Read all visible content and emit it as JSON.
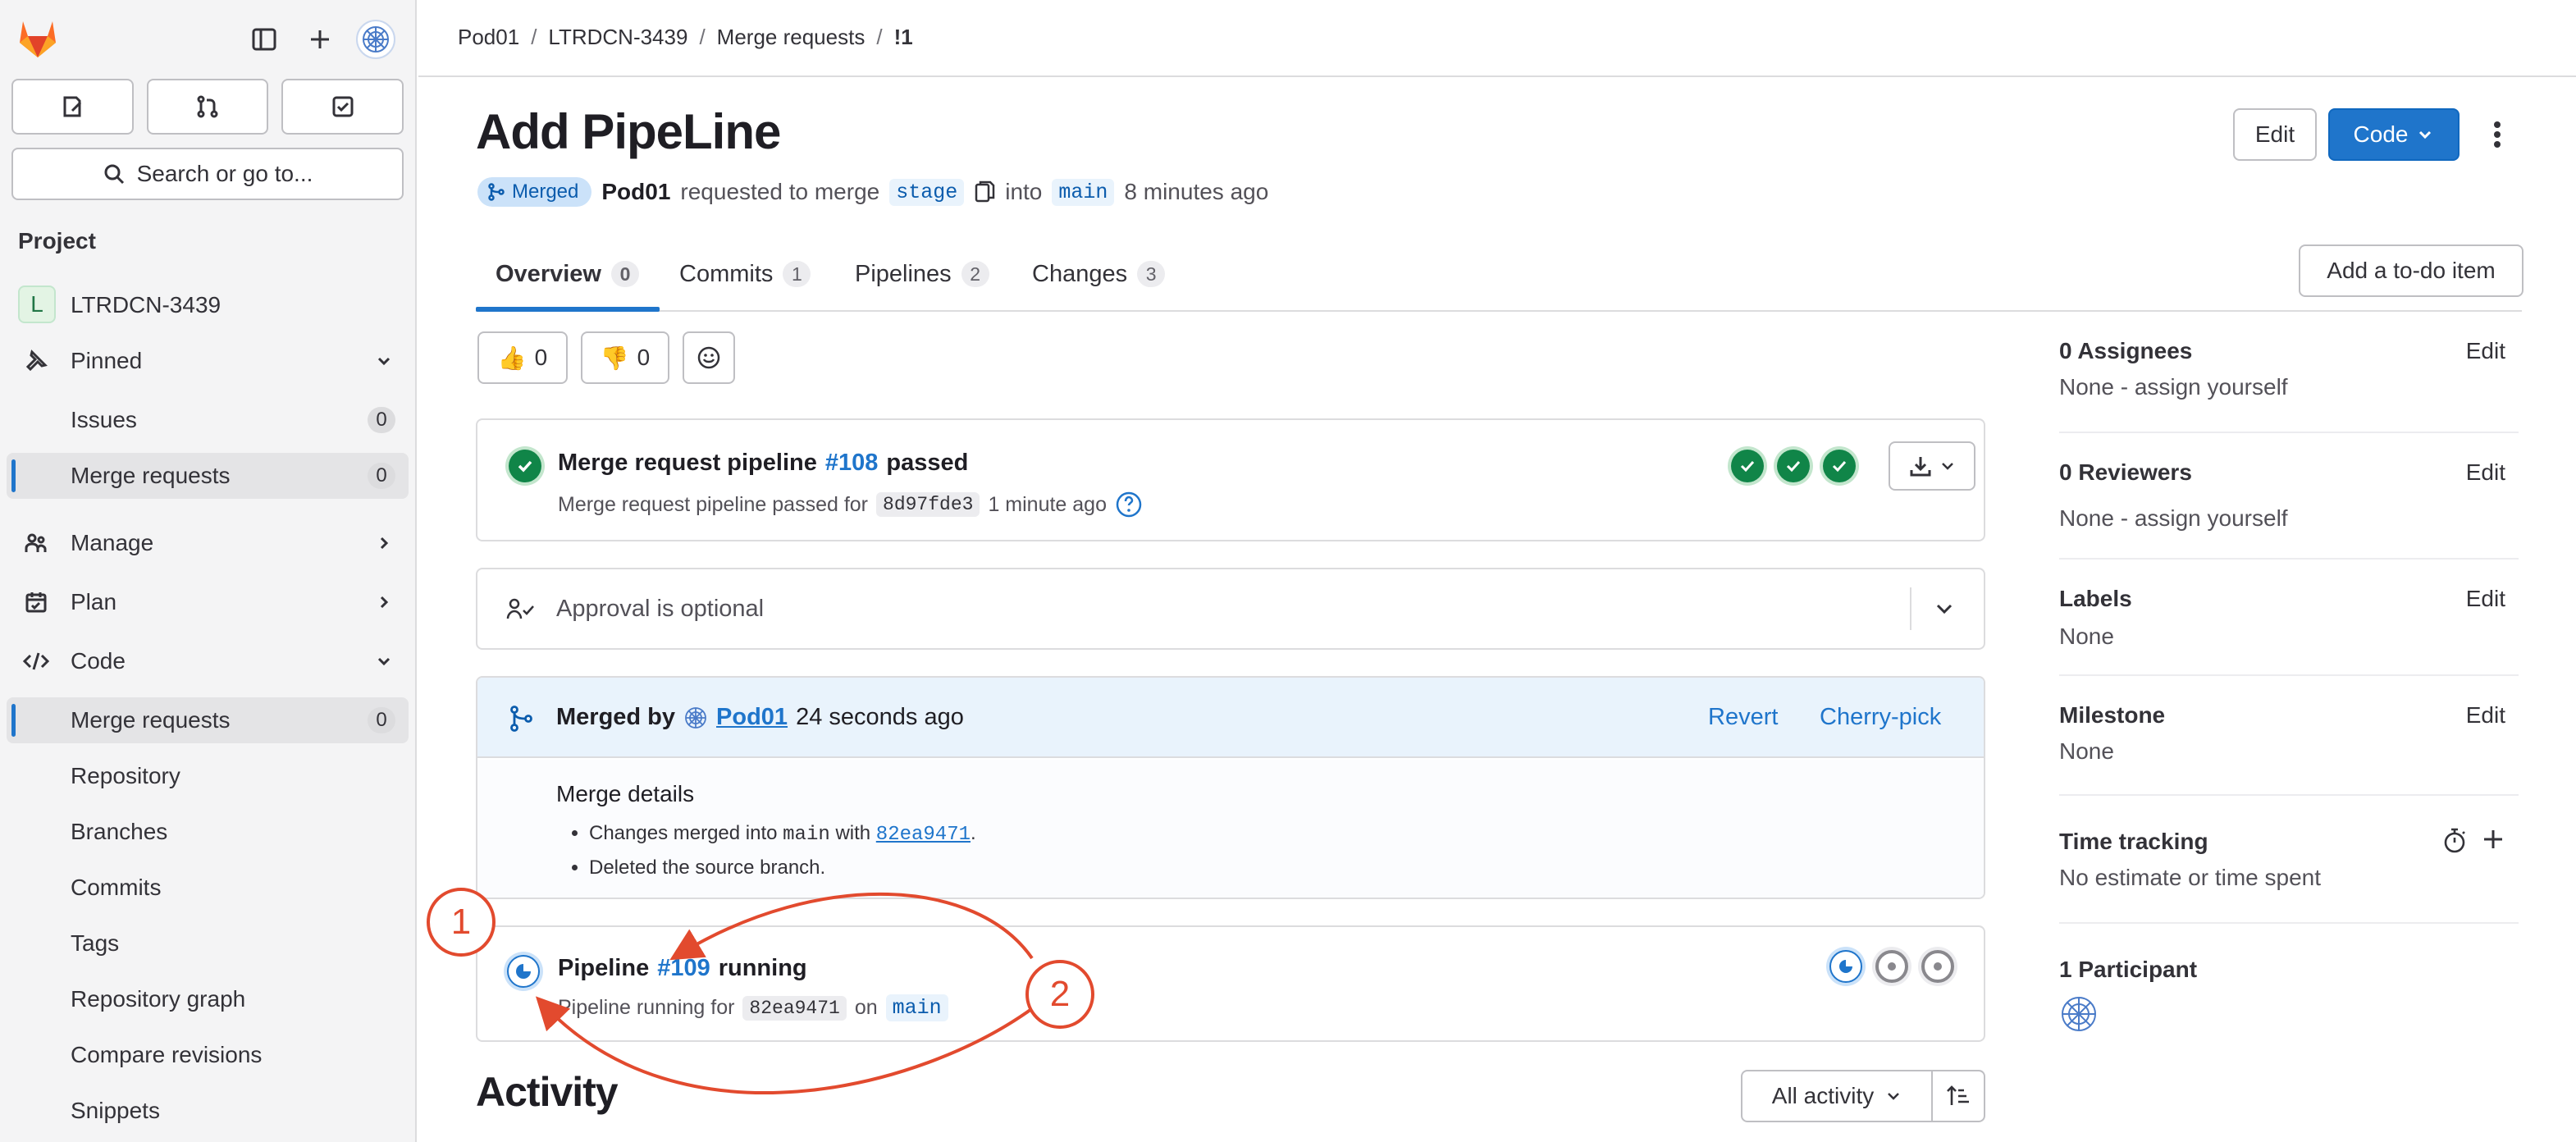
{
  "sidebar": {
    "search_label": "Search or go to...",
    "project_heading": "Project",
    "project_initial": "L",
    "project_name": "LTRDCN-3439",
    "pinned": "Pinned",
    "pinned_items": [
      {
        "label": "Issues",
        "count": "0"
      },
      {
        "label": "Merge requests",
        "count": "0"
      }
    ],
    "manage": "Manage",
    "plan": "Plan",
    "code": "Code",
    "code_items": [
      {
        "label": "Merge requests",
        "count": "0"
      },
      {
        "label": "Repository"
      },
      {
        "label": "Branches"
      },
      {
        "label": "Commits"
      },
      {
        "label": "Tags"
      },
      {
        "label": "Repository graph"
      },
      {
        "label": "Compare revisions"
      },
      {
        "label": "Snippets"
      }
    ]
  },
  "breadcrumb": [
    "Pod01",
    "LTRDCN-3439",
    "Merge requests",
    "!1"
  ],
  "mr": {
    "title": "Add PipeLine",
    "edit_label": "Edit",
    "code_label": "Code",
    "status": "Merged",
    "author": "Pod01",
    "requested_text": "requested to merge",
    "source_branch": "stage",
    "into_text": "into",
    "target_branch": "main",
    "time": "8 minutes ago",
    "todo_label": "Add a to-do item"
  },
  "tabs": [
    {
      "label": "Overview",
      "count": "0"
    },
    {
      "label": "Commits",
      "count": "1"
    },
    {
      "label": "Pipelines",
      "count": "2"
    },
    {
      "label": "Changes",
      "count": "3"
    }
  ],
  "reactions": {
    "thumbs_up": "0",
    "thumbs_down": "0"
  },
  "pipeline_card": {
    "prefix": "Merge request pipeline",
    "id": "#108",
    "status": "passed",
    "sub_prefix": "Merge request pipeline passed for",
    "sha": "8d97fde3",
    "time": "1 minute ago"
  },
  "approval": {
    "text": "Approval is optional"
  },
  "merged": {
    "by_label": "Merged by",
    "user": "Pod01",
    "time": "24 seconds ago",
    "revert": "Revert",
    "cherry_pick": "Cherry-pick",
    "details_title": "Merge details",
    "detail_1_pre": "Changes merged into",
    "detail_1_branch": "main",
    "detail_1_with": "with",
    "detail_1_sha": "82ea9471",
    "detail_2": "Deleted the source branch."
  },
  "pipeline_running": {
    "prefix": "Pipeline",
    "id": "#109",
    "status": "running",
    "sub_prefix": "Pipeline running for",
    "sha": "82ea9471",
    "on": "on",
    "branch": "main"
  },
  "activity": {
    "title": "Activity",
    "filter": "All activity"
  },
  "right_panel": {
    "assignees_title": "0 Assignees",
    "assignees_value": "None - assign yourself",
    "reviewers_title": "0 Reviewers",
    "reviewers_value": "None - assign yourself",
    "labels_title": "Labels",
    "labels_value": "None",
    "milestone_title": "Milestone",
    "milestone_value": "None",
    "time_title": "Time tracking",
    "time_value": "No estimate or time spent",
    "participants_title": "1 Participant",
    "edit": "Edit"
  },
  "annotations": {
    "one": "1",
    "two": "2"
  },
  "colors": {
    "accent": "#1f75cb",
    "success": "#108548",
    "annotation": "#e24a2e"
  }
}
